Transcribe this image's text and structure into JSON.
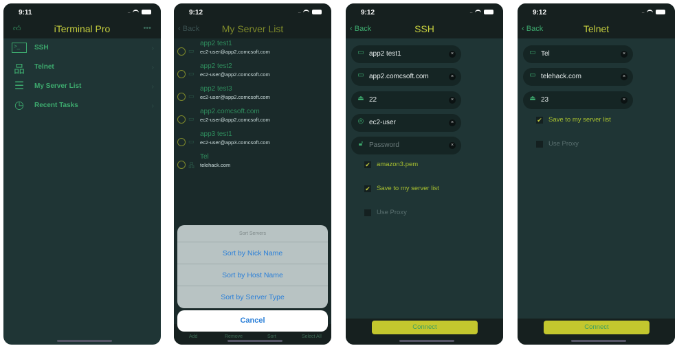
{
  "status": {
    "time1": "9:11",
    "time2": "9:12",
    "time3": "9:12",
    "time4": "9:12"
  },
  "home": {
    "title": "iTerminal Pro",
    "items": [
      {
        "label": "SSH",
        "icon": "terminal-icon"
      },
      {
        "label": "Telnet",
        "icon": "network-icon"
      },
      {
        "label": "My Server List",
        "icon": "list-icon"
      },
      {
        "label": "Recent Tasks",
        "icon": "clock-icon"
      }
    ]
  },
  "list": {
    "back": "Back",
    "title": "My Server List",
    "servers": [
      {
        "name": "app2 test1",
        "host": "ec2-user@app2.comcsoft.com"
      },
      {
        "name": "app2 test2",
        "host": "ec2-user@app2.comcsoft.com"
      },
      {
        "name": "app2 test3",
        "host": "ec2-user@app2.comcsoft.com"
      },
      {
        "name": "app2.comcsoft.com",
        "host": "ec2-user@app2.comcsoft.com"
      },
      {
        "name": "app3 test1",
        "host": "ec2-user@app3.comcsoft.com"
      },
      {
        "name": "Tel",
        "host": "telehack.com"
      }
    ],
    "sheet": {
      "title": "Sort Servers",
      "options": [
        "Sort by Nick Name",
        "Sort by Host Name",
        "Sort by Server Type"
      ],
      "cancel": "Cancel"
    },
    "toolbar": [
      "Add",
      "Remove",
      "Sort",
      "Select All"
    ]
  },
  "ssh": {
    "back": "Back",
    "title": "SSH",
    "fields": [
      {
        "value": "app2 test1"
      },
      {
        "value": "app2.comcsoft.com"
      },
      {
        "value": "22"
      },
      {
        "value": "ec2-user"
      },
      {
        "placeholder": "Password"
      }
    ],
    "key": "amazon3.pem",
    "save": "Save to my server list",
    "proxy": "Use Proxy",
    "connect": "Connect",
    "key_checked": true,
    "save_checked": true,
    "proxy_checked": false
  },
  "telnet": {
    "back": "Back",
    "title": "Telnet",
    "fields": [
      {
        "value": "Tel"
      },
      {
        "value": "telehack.com"
      },
      {
        "value": "23"
      }
    ],
    "save": "Save to my server list",
    "proxy": "Use Proxy",
    "connect": "Connect",
    "save_checked": true,
    "proxy_checked": false
  },
  "colors": {
    "background": "#1f3535",
    "title": "#c6cf3e",
    "accent": "#3daa6e",
    "connect": "#c3c72e",
    "sheet_link": "#2a7fd8"
  }
}
